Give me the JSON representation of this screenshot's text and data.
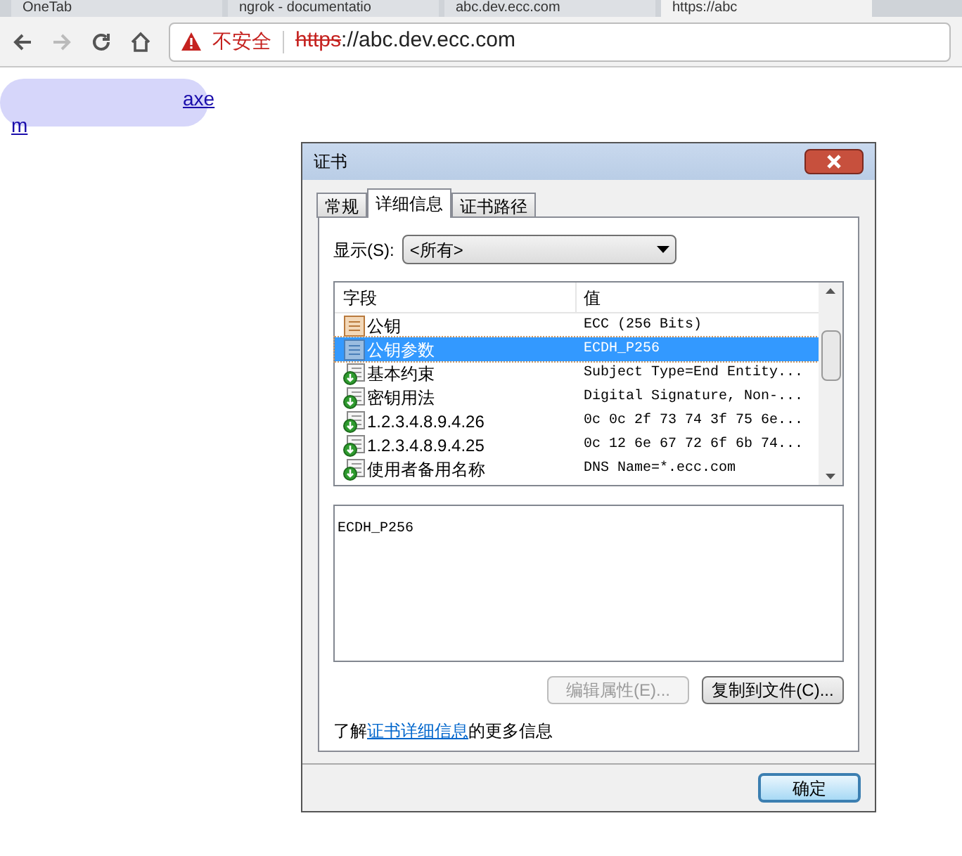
{
  "browser": {
    "tabs": [
      {
        "title": "OneTab",
        "selected": false
      },
      {
        "title": "ngrok - documentatio",
        "selected": false
      },
      {
        "title": "abc.dev.ecc.com",
        "selected": false
      },
      {
        "title": "https://abc",
        "selected": true
      }
    ],
    "security_label": "不安全",
    "url_scheme": "https",
    "url_rest": "://abc.dev.ecc.com"
  },
  "page": {
    "links": [
      "axe",
      "m"
    ]
  },
  "dialog": {
    "title": "证书",
    "tabs": [
      {
        "label": "常规",
        "selected": false
      },
      {
        "label": "详细信息",
        "selected": true
      },
      {
        "label": "证书路径",
        "selected": false
      }
    ],
    "show_label": "显示(S):",
    "show_value": "<所有>",
    "columns": [
      "字段",
      "值"
    ],
    "rows": [
      {
        "kind": "property",
        "field": "公钥",
        "value": "ECC (256 Bits)",
        "selected": false
      },
      {
        "kind": "property",
        "field": "公钥参数",
        "value": "ECDH_P256",
        "selected": true
      },
      {
        "kind": "extension",
        "field": "基本约束",
        "value": "Subject Type=End Entity...",
        "selected": false
      },
      {
        "kind": "extension",
        "field": "密钥用法",
        "value": "Digital Signature, Non-...",
        "selected": false
      },
      {
        "kind": "extension",
        "field": "1.2.3.4.8.9.4.26",
        "value": "0c 0c 2f 73 74 3f 75 6e...",
        "selected": false
      },
      {
        "kind": "extension",
        "field": "1.2.3.4.8.9.4.25",
        "value": "0c 12 6e 67 72 6f 6b 74...",
        "selected": false
      },
      {
        "kind": "extension",
        "field": "使用者备用名称",
        "value": "DNS Name=*.ecc.com",
        "selected": false
      }
    ],
    "detail_text": "ECDH_P256",
    "buttons": [
      {
        "label": "编辑属性(E)...",
        "disabled": true
      },
      {
        "label": "复制到文件(C)...",
        "disabled": false
      }
    ],
    "info_prefix": "了解",
    "info_link": "证书详细信息",
    "info_suffix": "的更多信息",
    "ok_button": "确定"
  }
}
